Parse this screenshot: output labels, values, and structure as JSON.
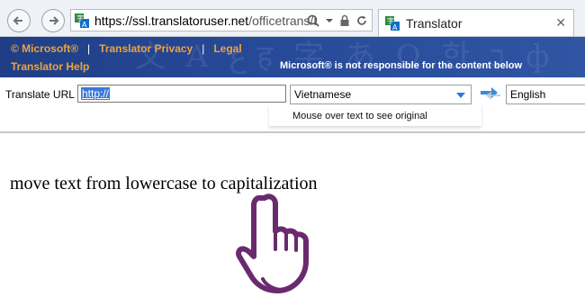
{
  "browser": {
    "url_domain": "https://ssl.translatoruser.net",
    "url_path": "/officetrans/H",
    "tab_title": "Translator",
    "tab_close": "✕",
    "icons": [
      "back-icon",
      "forward-icon",
      "translator-icon",
      "search-icon",
      "dropdown-icon",
      "lock-icon",
      "refresh-icon"
    ]
  },
  "banner": {
    "microsoft_link": "© Microsoft®",
    "privacy_link": "Translator Privacy",
    "legal_link": "Legal",
    "sep": "|",
    "help_link": "Translator Help",
    "disclaimer": "Microsoft® is not responsible for the content below"
  },
  "toolbar": {
    "translate_label": "Translate URL",
    "url_value": "http://",
    "source_language": "Vietnamese",
    "target_language": "English",
    "hint": "Mouse over text to see original"
  },
  "content": {
    "text": "move text from lowercase to capitalization"
  },
  "colors": {
    "banner": "#274a98",
    "link": "#f0a23a",
    "accent": "#2f7ad6",
    "hand": "#6a2a6e"
  }
}
